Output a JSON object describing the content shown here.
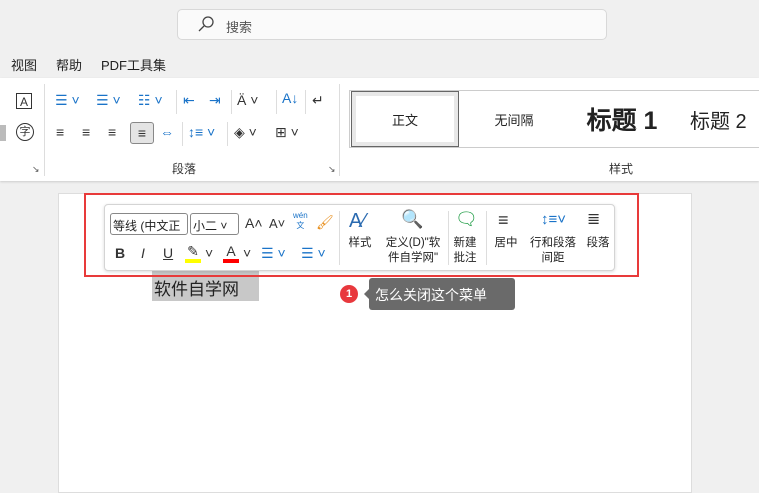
{
  "search": {
    "placeholder": "搜索"
  },
  "menu": [
    "视图",
    "帮助",
    "PDF工具集"
  ],
  "ribbon": {
    "paragraph_group": "段落",
    "styles_group": "样式",
    "styles": [
      {
        "label": "正文"
      },
      {
        "label": "无间隔"
      },
      {
        "label": "标题 1"
      },
      {
        "label": "标题 2"
      }
    ]
  },
  "mini_toolbar": {
    "font_name": "等线 (中文正",
    "font_size": "小二",
    "bold": "B",
    "italic": "I",
    "underline": "U",
    "highlight_color": "#ffff00",
    "font_color": "#ff0000",
    "styles_label": "样式",
    "define_label": "定义(D)\"软件自学网\"",
    "new_comment_label": "新建批注",
    "center_label": "居中",
    "spacing_label": "行和段落间距",
    "paragraph_label": "段落"
  },
  "document": {
    "selected_text": "软件自学网"
  },
  "callout": {
    "number": "1",
    "text": "怎么关闭这个菜单"
  },
  "colors": {
    "highlight_box": "#e83a3a",
    "badge": "#e8383d"
  }
}
